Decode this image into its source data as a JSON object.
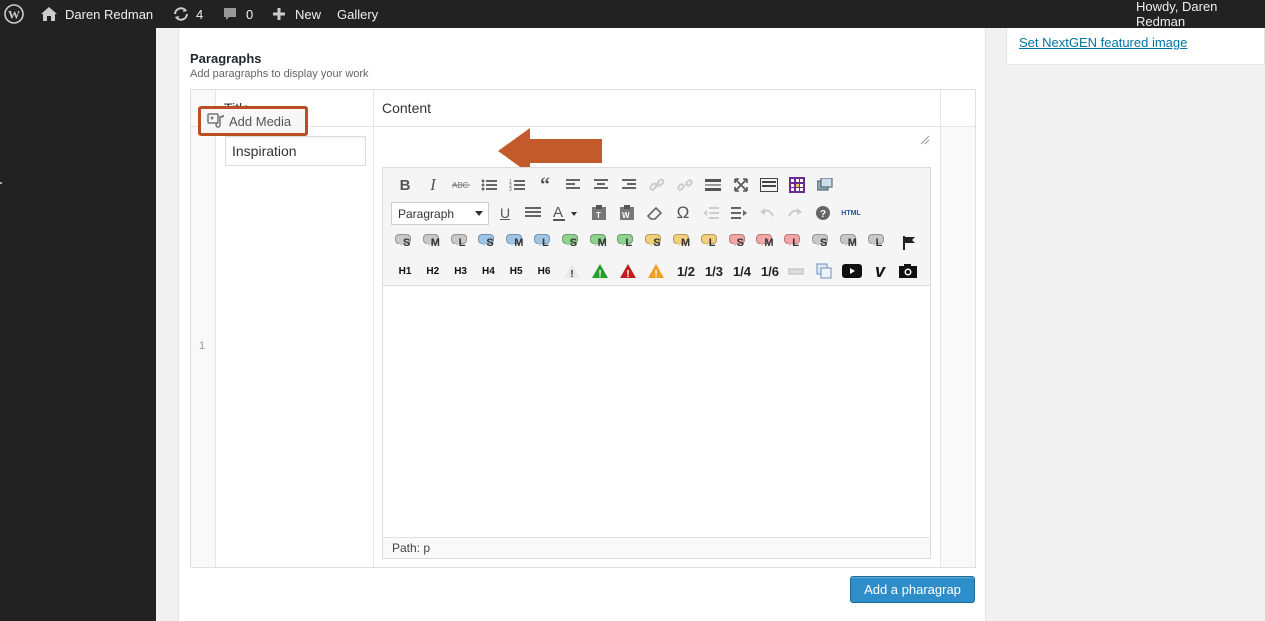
{
  "admin_bar": {
    "site_name": "Daren Redman",
    "updates_count": "4",
    "comments_count": "0",
    "new_label": "New",
    "gallery_label": "Gallery",
    "greeting": "Howdy, Daren Redman"
  },
  "right_panel": {
    "featured_link": "Set NextGEN featured image"
  },
  "section": {
    "title": "Paragraphs",
    "description": "Add paragraphs to display your work"
  },
  "table": {
    "headers": [
      "Title",
      "Content"
    ],
    "rows": [
      {
        "number": "1",
        "title_value": "Inspiration"
      }
    ]
  },
  "editor": {
    "add_media_label": "Add Media",
    "format_select": "Paragraph",
    "html_label": "HTML",
    "headings": [
      "H1",
      "H2",
      "H3",
      "H4",
      "H5",
      "H6"
    ],
    "fractions": [
      "1/2",
      "1/3",
      "1/4",
      "1/6"
    ],
    "bubble_sizes": [
      "S",
      "M",
      "L"
    ],
    "bubble_colors": [
      "#c8c8c8",
      "#9fc4e6",
      "#8fd18f",
      "#f2cf7a",
      "#f2a6a6",
      "#c8c8c8"
    ],
    "path_label": "Path: p"
  },
  "buttons": {
    "add_paragraph": "Add a pharagrap"
  },
  "colors": {
    "admin_bar": "#222222",
    "highlight_border": "#b94f22",
    "primary_button": "#2e8ec9",
    "link": "#0074a2"
  }
}
